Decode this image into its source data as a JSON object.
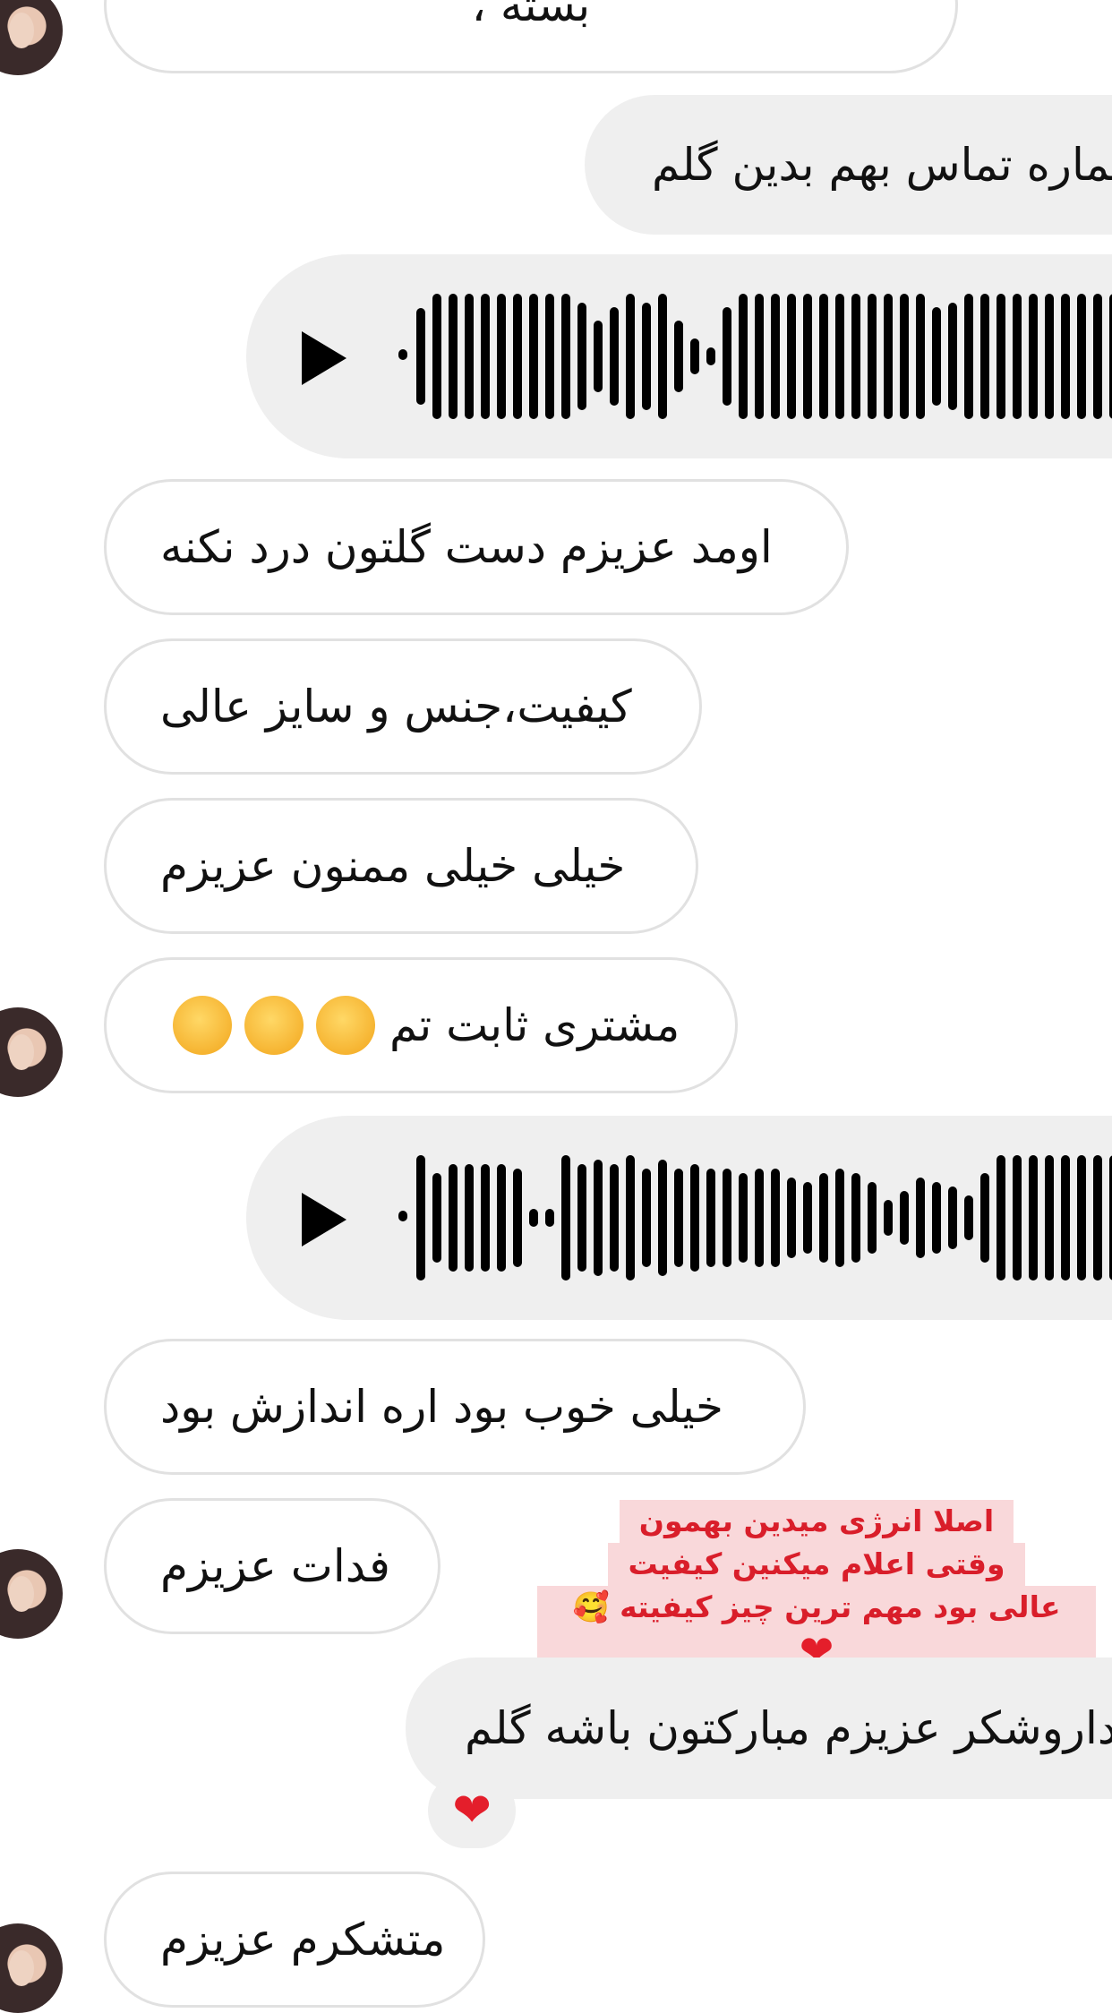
{
  "messages": {
    "m0": "بسته ،",
    "m1": "شماره تماس بهم بدین گلم",
    "m2": "اومد عزیزم دست گلتون درد نکنه",
    "m3": "کیفیت،جنس و سایز عالی",
    "m4": "خیلی خیلی ممنون عزیزم",
    "m5": "مشتری ثابت تم",
    "m6": "خیلی خوب بود اره اندازش بود",
    "m7": "فدات عزیزم",
    "m8": "خداروشکر عزیزم مبارکتون باشه گلم",
    "m9": "متشکرم عزیزم"
  },
  "sticker": {
    "line1": "اصلا انرژی میدین بهمون",
    "line2": "وقتی اعلام میکنین کیفیت",
    "line3": "عالی بود مهم ترین چیز کیفیته"
  },
  "reaction": {
    "icon": "heart-icon",
    "glyph": "❤️"
  },
  "emoji": {
    "wink": "wink-face-emoji",
    "count": 3
  },
  "colors": {
    "incoming_border": "#e1e1e1",
    "outgoing_bg": "#efefef",
    "sticker_text": "#d91e2a",
    "sticker_bg": "#f9d8da"
  }
}
